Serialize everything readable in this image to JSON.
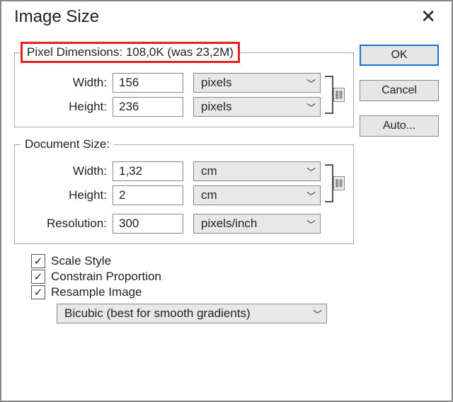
{
  "title": "Image Size",
  "buttons": {
    "ok": "OK",
    "cancel": "Cancel",
    "auto": "Auto..."
  },
  "pixel": {
    "legend": "Pixel Dimensions:  108,0K (was 23,2M)",
    "width_label": "Width:",
    "width_value": "156",
    "width_unit": "pixels",
    "height_label": "Height:",
    "height_value": "236",
    "height_unit": "pixels"
  },
  "doc": {
    "legend": "Document Size:",
    "width_label": "Width:",
    "width_value": "1,32",
    "width_unit": "cm",
    "height_label": "Height:",
    "height_value": "2",
    "height_unit": "cm",
    "res_label": "Resolution:",
    "res_value": "300",
    "res_unit": "pixels/inch"
  },
  "checks": {
    "scale": "Scale Style",
    "constrain": "Constrain Proportion",
    "resample": "Resample Image"
  },
  "resample_method": "Bicubic (best for smooth gradients)",
  "link_glyph": "⛓"
}
